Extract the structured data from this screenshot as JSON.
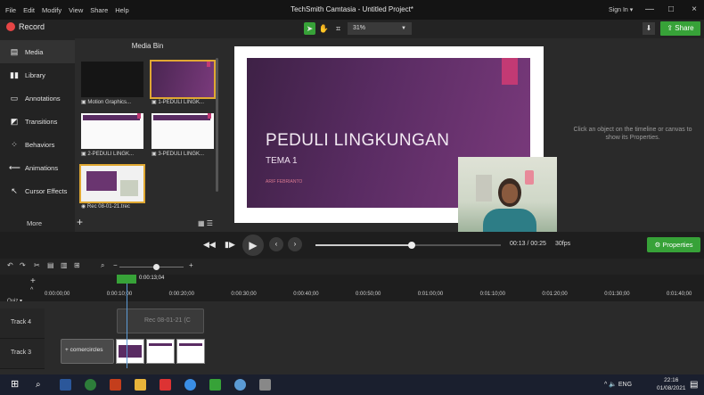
{
  "menu": [
    "File",
    "Edit",
    "Modify",
    "View",
    "Share",
    "Help"
  ],
  "app_title": "TechSmith Camtasia - Untitled Project*",
  "signin": "Sign In ▾",
  "window_controls": {
    "minimize": "—",
    "maximize": "□",
    "close": "×"
  },
  "toolbar": {
    "record_label": "Record",
    "zoom_value": "31%",
    "share_label": "Share",
    "accent_color": "#37a238"
  },
  "tools": {
    "items": [
      {
        "label": "Media",
        "icon": "film-icon"
      },
      {
        "label": "Library",
        "icon": "library-icon"
      },
      {
        "label": "Annotations",
        "icon": "annotation-icon"
      },
      {
        "label": "Transitions",
        "icon": "transition-icon"
      },
      {
        "label": "Behaviors",
        "icon": "behavior-icon"
      },
      {
        "label": "Animations",
        "icon": "animation-icon"
      },
      {
        "label": "Cursor Effects",
        "icon": "cursor-icon"
      }
    ],
    "more_label": "More"
  },
  "media_bin": {
    "title": "Media Bin",
    "items": [
      {
        "label": "Motion Graphics..."
      },
      {
        "label": "1-PEDULI LINGK..."
      },
      {
        "label": "2-PEDULI LINGK..."
      },
      {
        "label": "3-PEDULI LINGK..."
      },
      {
        "label": "Rec 08-01-21.trec"
      }
    ]
  },
  "canvas": {
    "slide_title": "PEDULI LINGKUNGAN",
    "slide_subtitle": "TEMA 1",
    "slide_author": "ARIF FEBRIANTO"
  },
  "properties_hint": "Click an object on the timeline or canvas to show its Properties.",
  "playback": {
    "timecode": "00:13 / 00:25",
    "fps": "30fps",
    "progress": 0.52,
    "properties_label": "Properties"
  },
  "timeline": {
    "playhead_time": "0:00:13;04",
    "quiz_label": "Quiz",
    "ticks": [
      "0:00:00;00",
      "0:00:10;00",
      "0:00:20;00",
      "0:00:30;00",
      "0:00:40;00",
      "0:00:50;00",
      "0:01:00;00",
      "0:01:10;00",
      "0:01:20;00",
      "0:01:30;00",
      "0:01:40;00"
    ],
    "tracks": [
      {
        "name": "Track 4"
      },
      {
        "name": "Track 3"
      }
    ],
    "clip_rec_label": "Rec 08-01-21 (C",
    "clip_circles_label": "+ cornercircles"
  },
  "taskbar": {
    "tray": "^  🔈 ENG",
    "time": "22:16",
    "date": "01/08/2021"
  }
}
